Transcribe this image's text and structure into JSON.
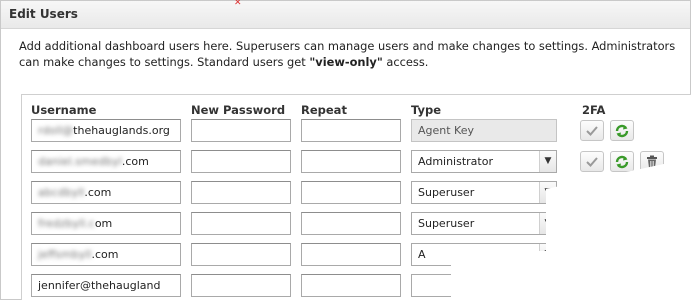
{
  "dialog": {
    "title": "Edit Users",
    "description_part1": "Add additional dashboard users here. Superusers can manage users and make changes to settings. Administrators can make changes to settings. Standard users get ",
    "description_bold": "\"view-only\"",
    "description_part2": " access."
  },
  "table": {
    "headers": {
      "username": "Username",
      "new_password": "New Password",
      "repeat": "Repeat",
      "type": "Type",
      "twofa": "2FA"
    },
    "rows": [
      {
        "username_hidden": "rdoll@",
        "username_visible": "thehauglands.org",
        "type": "Agent Key",
        "type_editable": false,
        "has_delete": false
      },
      {
        "username_hidden": "daniel.smedbyl",
        "username_visible": ".com",
        "type": "Administrator",
        "type_editable": true,
        "has_delete": true
      },
      {
        "username_hidden": "abcdbyll",
        "username_visible": ".com",
        "type": "Superuser",
        "type_editable": true,
        "has_delete": true
      },
      {
        "username_hidden": "fredzbyll.c",
        "username_visible": "om",
        "type": "Superuser",
        "type_editable": true,
        "has_delete": false
      },
      {
        "username_hidden": "jeffsmbyll",
        "username_visible": ".com",
        "type": "A",
        "type_editable": true,
        "has_delete": false
      },
      {
        "username_hidden": "",
        "username_visible": "jennifer@thehaugland",
        "type": "",
        "type_editable": true,
        "has_delete": false
      }
    ]
  },
  "icons": {
    "check": "check-icon",
    "refresh": "refresh-icon",
    "trash": "trash-icon",
    "dropdown": "chevron-down-icon"
  }
}
